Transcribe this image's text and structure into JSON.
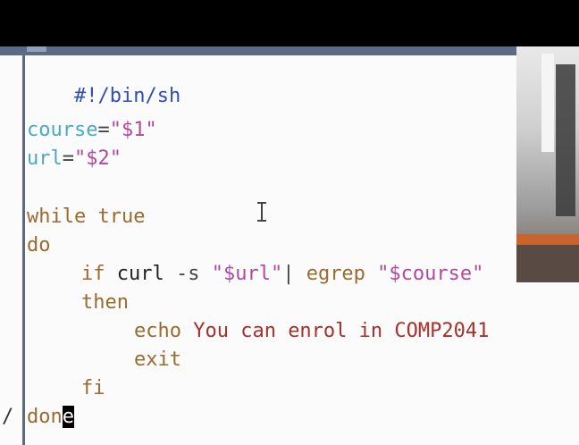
{
  "editor": {
    "lines": {
      "shebang": "#!/bin/sh",
      "course_var": "course",
      "course_eq": "=",
      "course_val": "\"$1\"",
      "url_var": "url",
      "url_eq": "=",
      "url_val": "\"$2\"",
      "while_kw": "while",
      "while_rest": " true",
      "do_kw": "do",
      "if_kw": "if",
      "curl": " curl",
      "flag": " -s",
      "url_str": " \"$url\"",
      "pipe": "|",
      "egrep": " egrep",
      "course_str": " \"$course\"",
      "then_kw": "then",
      "echo": "echo",
      "message": " You can enrol in COMP2041",
      "exit": "exit",
      "fi_kw": "fi",
      "done_pre": "don",
      "done_cursor": "e"
    },
    "gutter_mark": "/"
  }
}
